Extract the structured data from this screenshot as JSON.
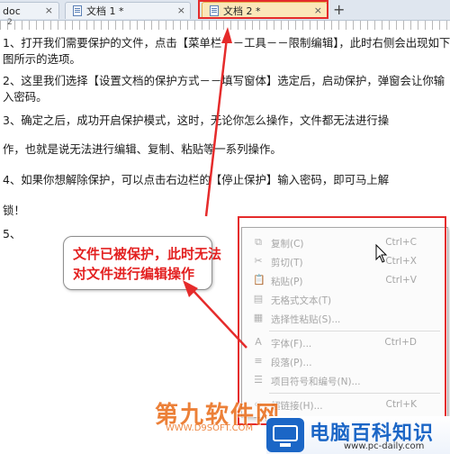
{
  "tabs": [
    {
      "label": "doc",
      "active": false
    },
    {
      "label": "文档 1 *",
      "active": false
    },
    {
      "label": "文档 2 *",
      "active": true
    }
  ],
  "new_tab_label": "+",
  "close_glyph": "×",
  "ruler_label": "2",
  "document": {
    "lines": [
      "1、打开我们需要保护的文件，点击【菜单栏－－工具－－限制编辑】，此时右侧会出现如下",
      "图所示的选项。",
      "2、这里我们选择【设置文档的保护方式－－填写窗体】选定后，启动保护，弹窗会让你输",
      "入密码。",
      "3、确定之后，成功开启保护模式，这时，无论你怎么操作，文件都无法进行操",
      "作，也就是说无法进行编辑、复制、粘贴等一系列操作。",
      "4、如果你想解除保护，可以点击右边栏的【停止保护】输入密码，即可马上解",
      "锁！",
      "5、"
    ]
  },
  "callout": {
    "line1": "文件已被保护，此时无法",
    "line2": "对文件进行编辑操作"
  },
  "menu": {
    "items": [
      {
        "icon": "copy-icon",
        "glyph": "⧉",
        "label": "复制(C)",
        "shortcut": "Ctrl+C"
      },
      {
        "icon": "cut-icon",
        "glyph": "✂",
        "label": "剪切(T)",
        "shortcut": "Ctrl+X"
      },
      {
        "icon": "paste-icon",
        "glyph": "📋",
        "label": "粘贴(P)",
        "shortcut": "Ctrl+V"
      },
      {
        "icon": "paste-plain-icon",
        "glyph": "▤",
        "label": "无格式文本(T)",
        "shortcut": ""
      },
      {
        "icon": "paste-special-icon",
        "glyph": "▦",
        "label": "选择性粘贴(S)...",
        "shortcut": ""
      },
      {
        "icon": "font-icon",
        "glyph": "A",
        "label": "字体(F)...",
        "shortcut": "Ctrl+D"
      },
      {
        "icon": "paragraph-icon",
        "glyph": "≡",
        "label": "段落(P)...",
        "shortcut": ""
      },
      {
        "icon": "bullets-icon",
        "glyph": "☰",
        "label": "项目符号和编号(N)...",
        "shortcut": ""
      },
      {
        "icon": "hyperlink-icon",
        "glyph": "∞",
        "label": "超链接(H)...",
        "shortcut": "Ctrl+K"
      }
    ]
  },
  "watermarks": {
    "left_title": "第九软件网",
    "left_url": "WWW.D9SOFT.COM",
    "right_title": "电脑百科知识",
    "right_url": "www.pc-daily.com"
  },
  "colors": {
    "annotation_red": "#e52b2b",
    "callout_text": "#e32020",
    "active_tab": "#fbe7b9",
    "brand_blue": "#1b66c6",
    "brand_orange": "#e96a16"
  }
}
